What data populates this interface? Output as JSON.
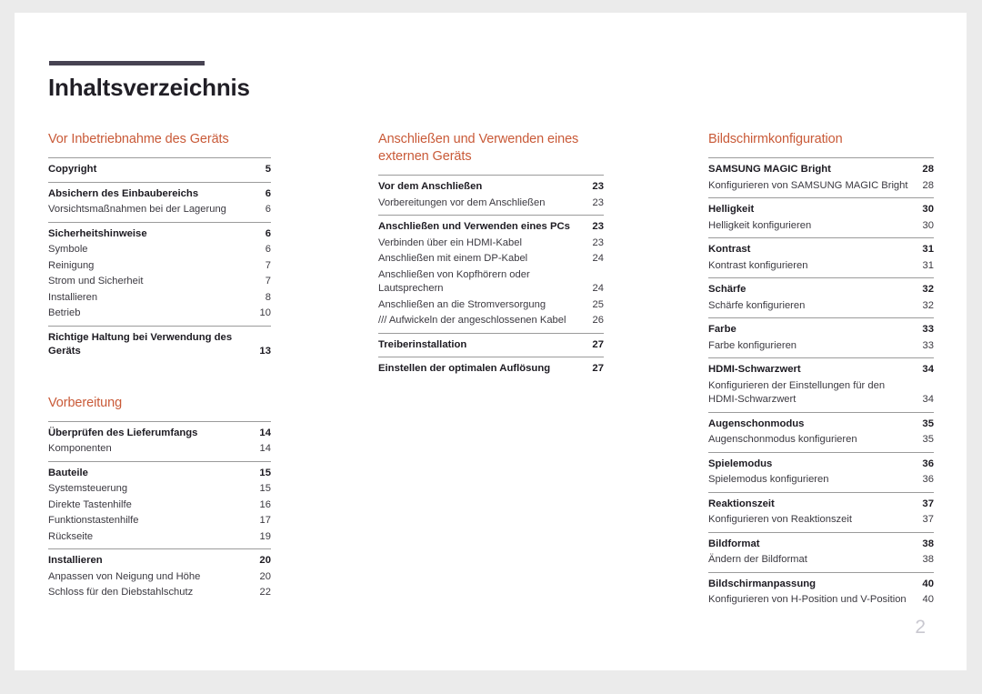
{
  "document": {
    "title": "Inhaltsverzeichnis",
    "page_number": "2",
    "accent_color": "#c95a38",
    "rule_color": "#474352",
    "divider_color": "#9b9b9b",
    "page_number_color": "#c9c8d0"
  },
  "columns": [
    {
      "sections": [
        {
          "title": "Vor Inbetriebnahme des Geräts",
          "groups": [
            {
              "entries": [
                {
                  "level": 1,
                  "label": "Copyright",
                  "page": "5"
                }
              ]
            },
            {
              "entries": [
                {
                  "level": 1,
                  "label": "Absichern des Einbaubereichs",
                  "page": "6"
                },
                {
                  "level": 2,
                  "label": "Vorsichtsmaßnahmen bei der Lagerung",
                  "page": "6"
                }
              ]
            },
            {
              "entries": [
                {
                  "level": 1,
                  "label": "Sicherheitshinweise",
                  "page": "6"
                },
                {
                  "level": 2,
                  "label": "Symbole",
                  "page": "6"
                },
                {
                  "level": 2,
                  "label": "Reinigung",
                  "page": "7"
                },
                {
                  "level": 2,
                  "label": "Strom und Sicherheit",
                  "page": "7"
                },
                {
                  "level": 2,
                  "label": "Installieren",
                  "page": "8"
                },
                {
                  "level": 2,
                  "label": "Betrieb",
                  "page": "10"
                }
              ]
            },
            {
              "entries": [
                {
                  "level": 1,
                  "label": "Richtige Haltung bei Verwendung des Geräts",
                  "page": "13",
                  "wrap": true
                }
              ]
            }
          ]
        },
        {
          "title": "Vorbereitung",
          "groups": [
            {
              "entries": [
                {
                  "level": 1,
                  "label": "Überprüfen des Lieferumfangs",
                  "page": "14"
                },
                {
                  "level": 2,
                  "label": "Komponenten",
                  "page": "14"
                }
              ]
            },
            {
              "entries": [
                {
                  "level": 1,
                  "label": "Bauteile",
                  "page": "15"
                },
                {
                  "level": 2,
                  "label": "Systemsteuerung",
                  "page": "15"
                },
                {
                  "level": 2,
                  "label": "Direkte Tastenhilfe",
                  "page": "16"
                },
                {
                  "level": 2,
                  "label": "Funktionstastenhilfe",
                  "page": "17"
                },
                {
                  "level": 2,
                  "label": "Rückseite",
                  "page": "19"
                }
              ]
            },
            {
              "entries": [
                {
                  "level": 1,
                  "label": "Installieren",
                  "page": "20"
                },
                {
                  "level": 2,
                  "label": "Anpassen von Neigung und Höhe",
                  "page": "20"
                },
                {
                  "level": 2,
                  "label": "Schloss für den Diebstahlschutz",
                  "page": "22"
                }
              ]
            }
          ]
        }
      ]
    },
    {
      "sections": [
        {
          "title": "Anschließen und Verwenden eines externen Geräts",
          "groups": [
            {
              "entries": [
                {
                  "level": 1,
                  "label": "Vor dem Anschließen",
                  "page": "23"
                },
                {
                  "level": 2,
                  "label": "Vorbereitungen vor dem Anschließen",
                  "page": "23"
                }
              ]
            },
            {
              "entries": [
                {
                  "level": 1,
                  "label": "Anschließen und Verwenden eines PCs",
                  "page": "23"
                },
                {
                  "level": 2,
                  "label": "Verbinden über ein HDMI-Kabel",
                  "page": "23"
                },
                {
                  "level": 2,
                  "label": "Anschließen mit einem DP-Kabel",
                  "page": "24"
                },
                {
                  "level": 2,
                  "label": "Anschließen von Kopfhörern oder Lautsprechern",
                  "page": "24",
                  "wrap": true
                },
                {
                  "level": 2,
                  "label": "Anschließen an die Stromversorgung",
                  "page": "25"
                },
                {
                  "level": 2,
                  "label": "/// Aufwickeln der angeschlossenen Kabel",
                  "page": "26"
                }
              ]
            },
            {
              "entries": [
                {
                  "level": 1,
                  "label": "Treiberinstallation",
                  "page": "27"
                }
              ]
            },
            {
              "entries": [
                {
                  "level": 1,
                  "label": "Einstellen der optimalen Auflösung",
                  "page": "27"
                }
              ]
            }
          ]
        }
      ]
    },
    {
      "sections": [
        {
          "title": "Bildschirmkonfiguration",
          "groups": [
            {
              "entries": [
                {
                  "level": 1,
                  "label": "SAMSUNG MAGIC Bright",
                  "page": "28"
                },
                {
                  "level": 2,
                  "label": "Konfigurieren von SAMSUNG MAGIC Bright",
                  "page": "28"
                }
              ]
            },
            {
              "entries": [
                {
                  "level": 1,
                  "label": "Helligkeit",
                  "page": "30"
                },
                {
                  "level": 2,
                  "label": "Helligkeit konfigurieren",
                  "page": "30"
                }
              ]
            },
            {
              "entries": [
                {
                  "level": 1,
                  "label": "Kontrast",
                  "page": "31"
                },
                {
                  "level": 2,
                  "label": "Kontrast konfigurieren",
                  "page": "31"
                }
              ]
            },
            {
              "entries": [
                {
                  "level": 1,
                  "label": "Schärfe",
                  "page": "32"
                },
                {
                  "level": 2,
                  "label": "Schärfe konfigurieren",
                  "page": "32"
                }
              ]
            },
            {
              "entries": [
                {
                  "level": 1,
                  "label": "Farbe",
                  "page": "33"
                },
                {
                  "level": 2,
                  "label": "Farbe konfigurieren",
                  "page": "33"
                }
              ]
            },
            {
              "entries": [
                {
                  "level": 1,
                  "label": "HDMI-Schwarzwert",
                  "page": "34"
                },
                {
                  "level": 2,
                  "label": "Konfigurieren der Einstellungen für den HDMI-Schwarzwert",
                  "page": "34",
                  "wrap": true
                }
              ]
            },
            {
              "entries": [
                {
                  "level": 1,
                  "label": "Augenschonmodus",
                  "page": "35"
                },
                {
                  "level": 2,
                  "label": "Augenschonmodus konfigurieren",
                  "page": "35"
                }
              ]
            },
            {
              "entries": [
                {
                  "level": 1,
                  "label": "Spielemodus",
                  "page": "36"
                },
                {
                  "level": 2,
                  "label": "Spielemodus konfigurieren",
                  "page": "36"
                }
              ]
            },
            {
              "entries": [
                {
                  "level": 1,
                  "label": "Reaktionszeit",
                  "page": "37"
                },
                {
                  "level": 2,
                  "label": "Konfigurieren von Reaktionszeit",
                  "page": "37"
                }
              ]
            },
            {
              "entries": [
                {
                  "level": 1,
                  "label": "Bildformat",
                  "page": "38"
                },
                {
                  "level": 2,
                  "label": "Ändern der Bildformat",
                  "page": "38"
                }
              ]
            },
            {
              "entries": [
                {
                  "level": 1,
                  "label": "Bildschirmanpassung",
                  "page": "40"
                },
                {
                  "level": 2,
                  "label": "Konfigurieren von H-Position und V-Position",
                  "page": "40"
                }
              ]
            }
          ]
        }
      ]
    }
  ]
}
